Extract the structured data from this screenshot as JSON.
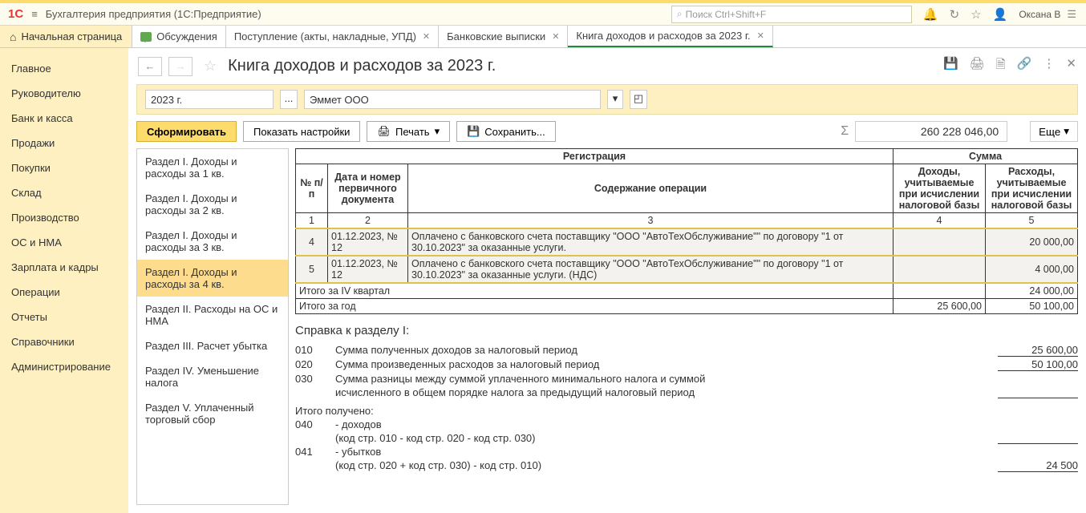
{
  "app": {
    "logo": "1C",
    "title": "Бухгалтерия предприятия  (1С:Предприятие)",
    "search_placeholder": "Поиск Ctrl+Shift+F",
    "user": "Оксана В"
  },
  "tabs": {
    "home": "Начальная страница",
    "items": [
      {
        "label": "Обсуждения",
        "closable": false,
        "icon": true
      },
      {
        "label": "Поступление (акты, накладные, УПД)",
        "closable": true
      },
      {
        "label": "Банковские выписки",
        "closable": true
      },
      {
        "label": "Книга доходов и расходов за 2023 г.",
        "closable": true,
        "active": true
      }
    ]
  },
  "left_nav": [
    "Главное",
    "Руководителю",
    "Банк и касса",
    "Продажи",
    "Покупки",
    "Склад",
    "Производство",
    "ОС и НМА",
    "Зарплата и кадры",
    "Операции",
    "Отчеты",
    "Справочники",
    "Администрирование"
  ],
  "page": {
    "title": "Книга доходов и расходов за 2023 г."
  },
  "filters": {
    "year": "2023 г.",
    "org": "Эммет ООО"
  },
  "toolbar": {
    "form": "Сформировать",
    "settings": "Показать настройки",
    "print": "Печать",
    "save": "Сохранить...",
    "more": "Еще",
    "sum": "260 228 046,00"
  },
  "sections": [
    "Раздел I. Доходы и расходы за 1 кв.",
    "Раздел I. Доходы и расходы за 2 кв.",
    "Раздел I. Доходы и расходы за 3 кв.",
    "Раздел I. Доходы и расходы за 4 кв.",
    "Раздел II. Расходы на ОС и НМА",
    "Раздел III. Расчет убытка",
    "Раздел IV. Уменьшение налога",
    "Раздел V. Уплаченный торговый сбор"
  ],
  "table": {
    "head": {
      "reg": "Регистрация",
      "sum": "Сумма",
      "no": "№ п/п",
      "doc": "Дата и номер первичного документа",
      "cont": "Содержание операции",
      "inc": "Доходы, учитываемые при исчислении налоговой базы",
      "exp": "Расходы, учитываемые при исчислении налоговой базы",
      "c1": "1",
      "c2": "2",
      "c3": "3",
      "c4": "4",
      "c5": "5"
    },
    "rows": [
      {
        "no": "4",
        "doc": "01.12.2023, № 12",
        "cont": "Оплачено с банковского счета поставщику \"ООО \"АвтоТехОбслуживание\"\" по договору \"1 от 30.10.2023\" за оказанные услуги.",
        "inc": "",
        "exp": "20 000,00"
      },
      {
        "no": "5",
        "doc": "01.12.2023, № 12",
        "cont": "Оплачено с банковского счета поставщику \"ООО \"АвтоТехОбслуживание\"\" по договору \"1 от 30.10.2023\" за оказанные услуги. (НДС)",
        "inc": "",
        "exp": "4 000,00"
      }
    ],
    "totals": [
      {
        "label": "Итого за IV квартал",
        "inc": "",
        "exp": "24 000,00"
      },
      {
        "label": "Итого за год",
        "inc": "25 600,00",
        "exp": "50 100,00"
      }
    ]
  },
  "ref": {
    "title": "Справка к разделу I:",
    "lines": [
      {
        "code": "010",
        "text": "Сумма полученных доходов за налоговый период",
        "val": "25 600,00"
      },
      {
        "code": "020",
        "text": "Сумма произведенных  расходов за налоговый период",
        "val": "50 100,00"
      },
      {
        "code": "030",
        "text": "Сумма разницы между  суммой уплаченного минимального налога и суммой",
        "val": ""
      }
    ],
    "line030b": "исчисленного в общем порядке налога за предыдущий налоговый период",
    "got": "Итого получено:",
    "got_lines": [
      {
        "code": "040",
        "text": "- доходов",
        "sub": "(код стр. 010 - код  стр. 020 - код стр. 030)",
        "val": ""
      },
      {
        "code": "041",
        "text": "- убытков",
        "sub": "(код стр. 020 + код  стр. 030) - код стр. 010)",
        "val": "24 500"
      }
    ]
  }
}
